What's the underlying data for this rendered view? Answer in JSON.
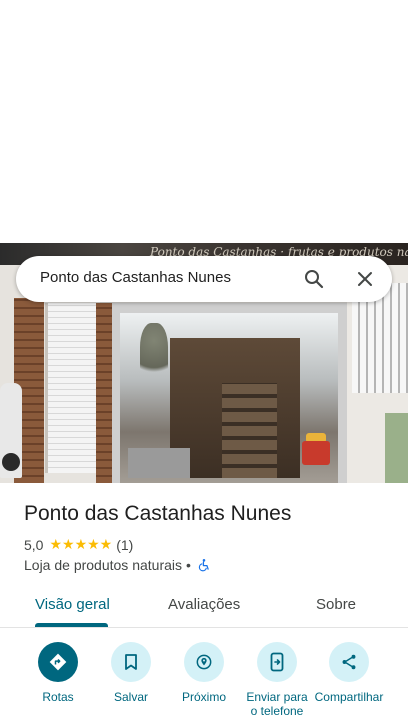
{
  "search": {
    "query": "Ponto das Castanhas Nunes"
  },
  "photo": {
    "sign_text": "Ponto das Castanhas · frutas e produtos naturais"
  },
  "place": {
    "name": "Ponto das Castanhas Nunes",
    "rating": "5,0",
    "stars": "★★★★★",
    "review_count": "(1)",
    "category": "Loja de produtos naturais",
    "separator": "•"
  },
  "tabs": [
    {
      "label": "Visão geral",
      "active": true
    },
    {
      "label": "Avaliações",
      "active": false
    },
    {
      "label": "Sobre",
      "active": false
    }
  ],
  "actions": [
    {
      "label": "Rotas",
      "icon": "directions-icon"
    },
    {
      "label": "Salvar",
      "icon": "bookmark-icon"
    },
    {
      "label": "Próximo",
      "icon": "nearby-icon"
    },
    {
      "label": "Enviar para o telefone",
      "icon": "send-to-phone-icon"
    },
    {
      "label": "Compartilhar",
      "icon": "share-icon"
    }
  ],
  "colors": {
    "accent": "#00677f",
    "accent_light": "#d4f1f7",
    "star": "#fbbc04",
    "accessibility": "#1a73e8"
  }
}
